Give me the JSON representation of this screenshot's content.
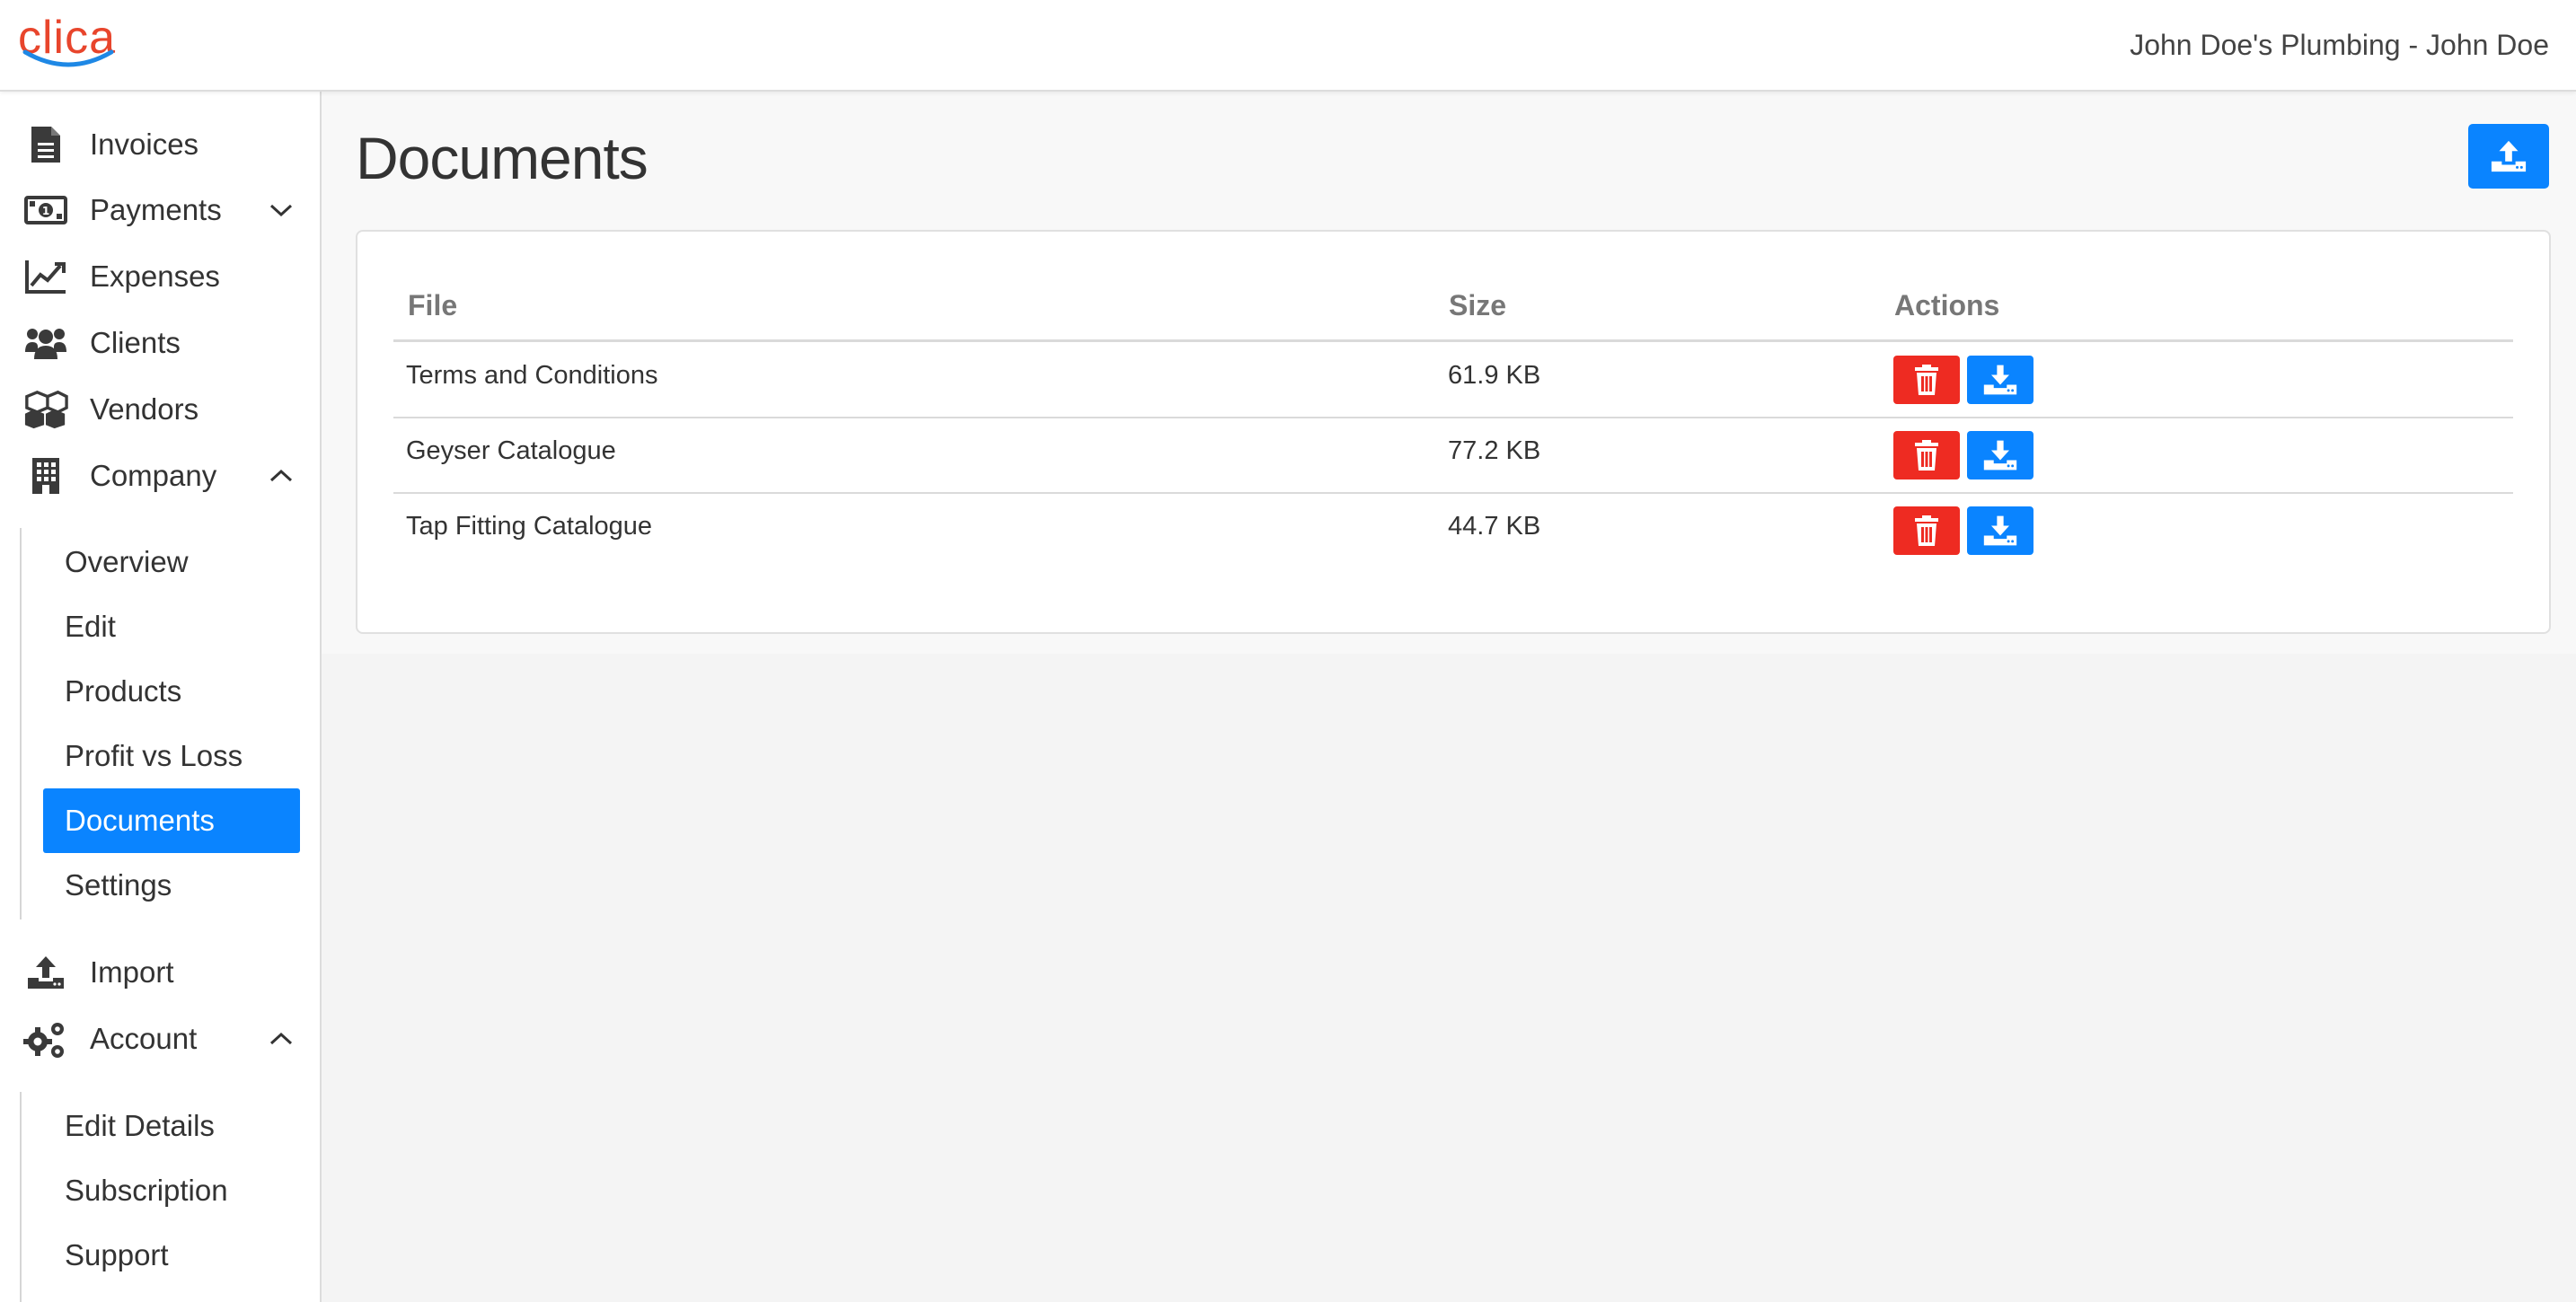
{
  "header": {
    "logo_text": "clica",
    "user_label": "John Doe's Plumbing - John Doe"
  },
  "sidebar": {
    "items": [
      {
        "label": "Invoices",
        "icon": "file-text-icon"
      },
      {
        "label": "Payments",
        "icon": "money-bill-icon",
        "chevron": "down"
      },
      {
        "label": "Expenses",
        "icon": "line-chart-icon"
      },
      {
        "label": "Clients",
        "icon": "users-icon"
      },
      {
        "label": "Vendors",
        "icon": "cubes-icon"
      },
      {
        "label": "Company",
        "icon": "building-icon",
        "chevron": "up"
      },
      {
        "label": "Import",
        "icon": "upload-icon"
      },
      {
        "label": "Account",
        "icon": "gears-icon",
        "chevron": "up"
      }
    ],
    "company_sub": [
      "Overview",
      "Edit",
      "Products",
      "Profit vs Loss",
      "Documents",
      "Settings"
    ],
    "account_sub": [
      "Edit Details",
      "Subscription",
      "Support"
    ],
    "active_item": "Documents"
  },
  "main": {
    "title": "Documents",
    "upload_icon": "upload-icon",
    "table": {
      "headers": [
        "File",
        "Size",
        "Actions"
      ],
      "rows": [
        {
          "file": "Terms and Conditions",
          "size": "61.9 KB"
        },
        {
          "file": "Geyser Catalogue",
          "size": "77.2 KB"
        },
        {
          "file": "Tap Fitting Catalogue",
          "size": "44.7 KB"
        }
      ]
    }
  },
  "colors": {
    "accent": "#0a84ff",
    "danger": "#ee2b22",
    "brand": "#e8452c"
  }
}
